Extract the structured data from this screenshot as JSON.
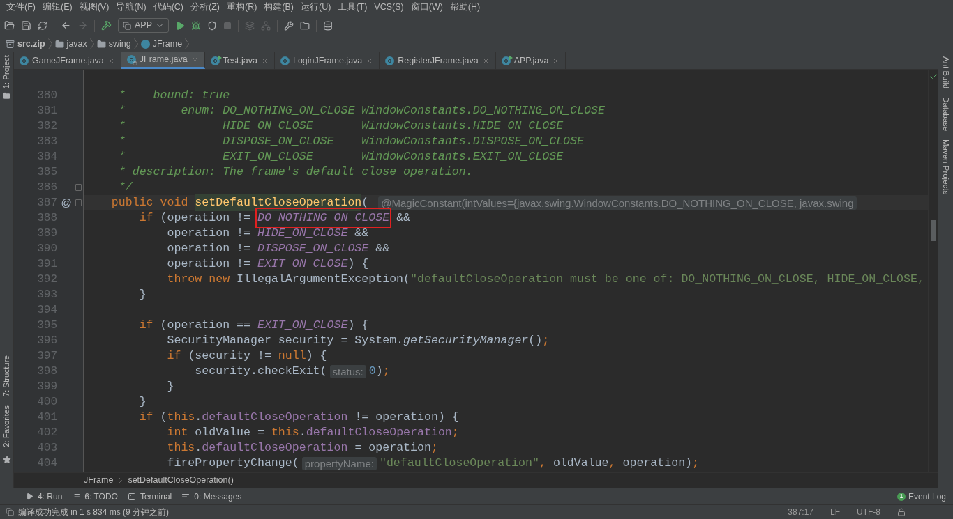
{
  "menu": [
    "文件(F)",
    "编辑(E)",
    "视图(V)",
    "导航(N)",
    "代码(C)",
    "分析(Z)",
    "重构(R)",
    "构建(B)",
    "运行(U)",
    "工具(T)",
    "VCS(S)",
    "窗口(W)",
    "帮助(H)"
  ],
  "toolbar": {
    "run_config": "APP"
  },
  "navigation_bar": [
    {
      "label": "src.zip",
      "kind": "archive"
    },
    {
      "label": "javax",
      "kind": "package"
    },
    {
      "label": "swing",
      "kind": "package"
    },
    {
      "label": "JFrame",
      "kind": "class"
    }
  ],
  "left_tool_windows": {
    "top": [
      "1: Project"
    ],
    "bottom": [
      "7: Structure",
      "2: Favorites"
    ]
  },
  "tabs": [
    {
      "label": "GameJFrame.java",
      "selected": false,
      "kind": "class"
    },
    {
      "label": "JFrame.java",
      "selected": true,
      "kind": "locked"
    },
    {
      "label": "Test.java",
      "selected": false,
      "kind": "runnable"
    },
    {
      "label": "LoginJFrame.java",
      "selected": false,
      "kind": "class"
    },
    {
      "label": "RegisterJFrame.java",
      "selected": false,
      "kind": "class"
    },
    {
      "label": "APP.java",
      "selected": false,
      "kind": "runnable"
    }
  ],
  "right_tool_windows": [
    "Ant Build",
    "Database",
    "Maven Projects"
  ],
  "editor": {
    "lines": [
      {
        "number": "380",
        "tokens": [
          {
            "kind": "comment",
            "text": "     *    bound: true"
          }
        ]
      },
      {
        "number": "381",
        "tokens": [
          {
            "kind": "comment",
            "text": "     *        enum: DO_NOTHING_ON_CLOSE WindowConstants.DO_NOTHING_ON_CLOSE"
          }
        ]
      },
      {
        "number": "382",
        "tokens": [
          {
            "kind": "comment",
            "text": "     *              HIDE_ON_CLOSE       WindowConstants.HIDE_ON_CLOSE"
          }
        ]
      },
      {
        "number": "383",
        "tokens": [
          {
            "kind": "comment",
            "text": "     *              DISPOSE_ON_CLOSE    WindowConstants.DISPOSE_ON_CLOSE"
          }
        ]
      },
      {
        "number": "384",
        "tokens": [
          {
            "kind": "comment",
            "text": "     *              EXIT_ON_CLOSE       WindowConstants.EXIT_ON_CLOSE"
          }
        ]
      },
      {
        "number": "385",
        "tokens": [
          {
            "kind": "comment",
            "text": "     * description: The frame's default close operation."
          }
        ]
      },
      {
        "number": "386",
        "fold": true,
        "tokens": [
          {
            "kind": "comment",
            "text": "     */"
          }
        ]
      },
      {
        "number": "387",
        "fold": true,
        "annotation_mark": "@",
        "current": true,
        "tokens": [
          {
            "kind": "keyword",
            "text": "    public void "
          },
          {
            "kind": "method_decl",
            "text": "setDefaultCloseOperation"
          },
          {
            "kind": "plain",
            "text": "( "
          },
          {
            "kind": "hint",
            "text": "@MagicConstant(intValues={javax.swing.WindowConstants.DO_NOTHING_ON_CLOSE, javax.swing"
          }
        ]
      },
      {
        "number": "388",
        "tokens": [
          {
            "kind": "keyword",
            "text": "        if "
          },
          {
            "kind": "plain",
            "text": "(operation != "
          },
          {
            "kind": "constant",
            "text": "DO_NOTHING_ON_CLOSE",
            "boxed": true
          },
          {
            "kind": "plain",
            "text": " &&"
          }
        ]
      },
      {
        "number": "389",
        "tokens": [
          {
            "kind": "plain",
            "text": "            operation != "
          },
          {
            "kind": "constant",
            "text": "HIDE_ON_CLOSE"
          },
          {
            "kind": "plain",
            "text": " &&"
          }
        ]
      },
      {
        "number": "390",
        "tokens": [
          {
            "kind": "plain",
            "text": "            operation != "
          },
          {
            "kind": "constant",
            "text": "DISPOSE_ON_CLOSE"
          },
          {
            "kind": "plain",
            "text": " &&"
          }
        ]
      },
      {
        "number": "391",
        "tokens": [
          {
            "kind": "plain",
            "text": "            operation != "
          },
          {
            "kind": "constant",
            "text": "EXIT_ON_CLOSE"
          },
          {
            "kind": "plain",
            "text": ") {"
          }
        ]
      },
      {
        "number": "392",
        "tokens": [
          {
            "kind": "keyword",
            "text": "            throw new "
          },
          {
            "kind": "plain",
            "text": "IllegalArgumentException("
          },
          {
            "kind": "string",
            "text": "\"defaultCloseOperation must be one of: DO_NOTHING_ON_CLOSE, HIDE_ON_CLOSE,"
          }
        ]
      },
      {
        "number": "393",
        "tokens": [
          {
            "kind": "plain",
            "text": "        }"
          }
        ]
      },
      {
        "number": "394"
      },
      {
        "number": "395",
        "tokens": [
          {
            "kind": "keyword",
            "text": "        if "
          },
          {
            "kind": "plain",
            "text": "(operation == "
          },
          {
            "kind": "constant",
            "text": "EXIT_ON_CLOSE"
          },
          {
            "kind": "plain",
            "text": ") {"
          }
        ]
      },
      {
        "number": "396",
        "tokens": [
          {
            "kind": "plain",
            "text": "            SecurityManager security = System."
          },
          {
            "kind": "static_call",
            "text": "getSecurityManager"
          },
          {
            "kind": "plain",
            "text": "()"
          },
          {
            "kind": "keyword",
            "text": ";"
          }
        ]
      },
      {
        "number": "397",
        "tokens": [
          {
            "kind": "keyword",
            "text": "            if "
          },
          {
            "kind": "plain",
            "text": "(security != "
          },
          {
            "kind": "keyword",
            "text": "null"
          },
          {
            "kind": "plain",
            "text": ") {"
          }
        ]
      },
      {
        "number": "398",
        "tokens": [
          {
            "kind": "plain",
            "text": "                security.checkExit("
          },
          {
            "kind": "hint",
            "text": "status:"
          },
          {
            "kind": "number",
            "text": "0"
          },
          {
            "kind": "plain",
            "text": ")"
          },
          {
            "kind": "keyword",
            "text": ";"
          }
        ]
      },
      {
        "number": "399",
        "tokens": [
          {
            "kind": "plain",
            "text": "            }"
          }
        ]
      },
      {
        "number": "400",
        "tokens": [
          {
            "kind": "plain",
            "text": "        }"
          }
        ]
      },
      {
        "number": "401",
        "tokens": [
          {
            "kind": "keyword",
            "text": "        if "
          },
          {
            "kind": "plain",
            "text": "("
          },
          {
            "kind": "keyword",
            "text": "this"
          },
          {
            "kind": "plain",
            "text": "."
          },
          {
            "kind": "field",
            "text": "defaultCloseOperation"
          },
          {
            "kind": "plain",
            "text": " != operation) {"
          }
        ]
      },
      {
        "number": "402",
        "tokens": [
          {
            "kind": "keyword",
            "text": "            int "
          },
          {
            "kind": "plain",
            "text": "oldValue = "
          },
          {
            "kind": "keyword",
            "text": "this"
          },
          {
            "kind": "plain",
            "text": "."
          },
          {
            "kind": "field",
            "text": "defaultCloseOperation"
          },
          {
            "kind": "keyword",
            "text": ";"
          }
        ]
      },
      {
        "number": "403",
        "tokens": [
          {
            "kind": "keyword",
            "text": "            this"
          },
          {
            "kind": "plain",
            "text": "."
          },
          {
            "kind": "field",
            "text": "defaultCloseOperation"
          },
          {
            "kind": "plain",
            "text": " = operation"
          },
          {
            "kind": "keyword",
            "text": ";"
          }
        ]
      },
      {
        "number": "404",
        "tokens": [
          {
            "kind": "plain",
            "text": "            firePropertyChange("
          },
          {
            "kind": "hint",
            "text": "propertyName:"
          },
          {
            "kind": "string",
            "text": "\"defaultCloseOperation\""
          },
          {
            "kind": "keyword",
            "text": ", "
          },
          {
            "kind": "plain",
            "text": "oldValue"
          },
          {
            "kind": "keyword",
            "text": ", "
          },
          {
            "kind": "plain",
            "text": "operation)"
          },
          {
            "kind": "keyword",
            "text": ";"
          }
        ]
      }
    ]
  },
  "editor_breadcrumb": [
    "JFrame",
    "setDefaultCloseOperation()"
  ],
  "bottom_tool_windows": [
    {
      "label": "4: Run",
      "kind": "run"
    },
    {
      "label": "6: TODO",
      "kind": "todo"
    },
    {
      "label": "Terminal",
      "kind": "terminal"
    },
    {
      "label": "0: Messages",
      "kind": "messages"
    }
  ],
  "event_log": {
    "badge": "1",
    "label": "Event Log"
  },
  "status_bar": {
    "message": "编译成功完成 in 1 s 834 ms (9 分钟之前)",
    "position": "387:17",
    "line_separator": "LF",
    "encoding": "UTF-8"
  }
}
